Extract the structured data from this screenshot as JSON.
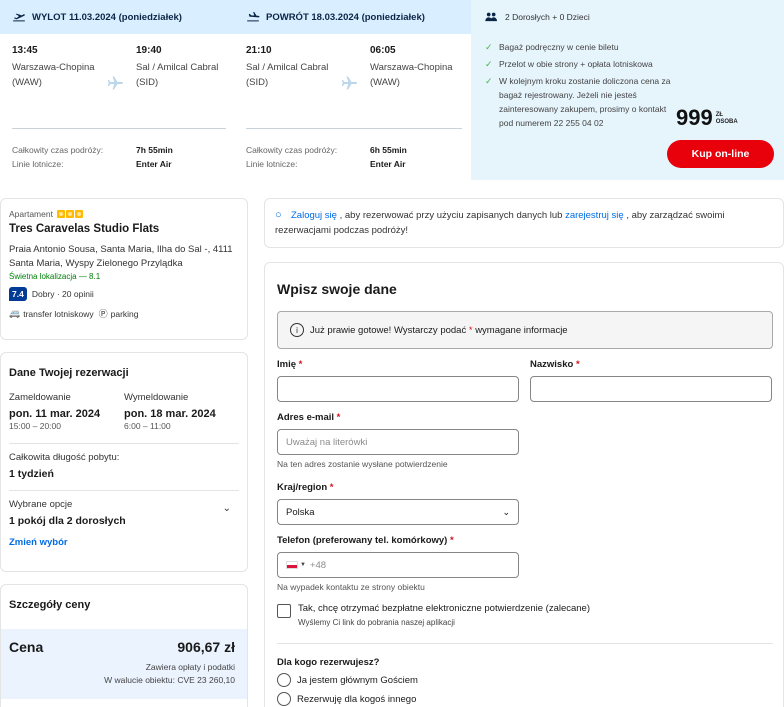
{
  "outbound": {
    "header": "WYLOT 11.03.2024 (poniedziałek)",
    "dep_time": "13:45",
    "dep_airport": "Warszawa-Chopina",
    "dep_code": "(WAW)",
    "arr_time": "19:40",
    "arr_airport": "Sal / Amilcal Cabral",
    "arr_code": "(SID)",
    "duration_label": "Całkowity czas podróży:",
    "duration": "7h 55min",
    "airline_label": "Linie lotnicze:",
    "airline": "Enter Air"
  },
  "return": {
    "header": "POWRÓT 18.03.2024 (poniedziałek)",
    "dep_time": "21:10",
    "dep_airport": "Sal / Amilcal Cabral",
    "dep_code": "(SID)",
    "arr_time": "06:05",
    "arr_airport": "Warszawa-Chopina",
    "arr_code": "(WAW)",
    "duration_label": "Całkowity czas podróży:",
    "duration": "6h 55min",
    "airline_label": "Linie lotnicze:",
    "airline": "Enter Air"
  },
  "offer": {
    "passengers": "2 Dorosłych + 0 Dzieci",
    "bullets": [
      "Bagaż podręczny w cenie biletu",
      "Przelot w obie strony + opłata lotniskowa",
      "W kolejnym kroku zostanie doliczona cena za bagaż rejestrowany. Jeżeli nie jesteś zainteresowany zakupem, prosimy o kontakt pod numerem 22 255 04 02"
    ],
    "price": "999",
    "currency": "ZŁ",
    "per": "OSOBA",
    "buy_label": "Kup on-line"
  },
  "hotel": {
    "type": "Apartament",
    "name": "Tres Caravelas Studio Flats",
    "address": "Praia Antonio Sousa, Santa Maria, Ilha do Sal -, 4111 Santa Maria, Wyspy Zielonego Przylądka",
    "location_score": "Świetna lokalizacja — 8.1",
    "score": "7.4",
    "score_text": "Dobry · 20 opinii",
    "amenity_transfer": "transfer lotniskowy",
    "amenity_parking": "parking"
  },
  "booking": {
    "title": "Dane Twojej rezerwacji",
    "checkin_label": "Zameldowanie",
    "checkin_date": "pon. 11 mar. 2024",
    "checkin_hours": "15:00 – 20:00",
    "checkout_label": "Wymeldowanie",
    "checkout_date": "pon. 18 mar. 2024",
    "checkout_hours": "6:00 – 11:00",
    "duration_label": "Całkowita długość pobytu:",
    "duration": "1 tydzień",
    "options_label": "Wybrane opcje",
    "options": "1 pokój dla 2 dorosłych",
    "change_label": "Zmień wybór"
  },
  "price_details": {
    "title": "Szczegóły ceny",
    "label": "Cena",
    "amount": "906,67 zł",
    "note1": "Zawiera opłaty i podatki",
    "note2": "W walucie obiektu: CVE 23 260,10"
  },
  "signin": {
    "link1": "Zaloguj się",
    "text1": ", aby rezerwować przy użyciu zapisanych danych lub",
    "link2": "zarejestruj się",
    "text2": ", aby zarządzać swoimi rezerwacjami podczas podróży!"
  },
  "form": {
    "title": "Wpisz swoje dane",
    "info_text": "Już prawie gotowe! Wystarczy podać",
    "info_text2": "wymagane informacje",
    "first_name_label": "Imię",
    "last_name_label": "Nazwisko",
    "email_label": "Adres e-mail",
    "email_placeholder": "Uważaj na literówki",
    "email_hint": "Na ten adres zostanie wysłane potwierdzenie",
    "country_label": "Kraj/region",
    "country_value": "Polska",
    "phone_label": "Telefon (preferowany tel. komórkowy)",
    "phone_prefix": "+48",
    "phone_hint": "Na wypadek kontaktu ze strony obiektu",
    "confirm_label": "Tak, chcę otrzymać bezpłatne elektroniczne potwierdzenie (zalecane)",
    "confirm_sub": "Wyślemy Ci link do pobrania naszej aplikacji",
    "who_label": "Dla kogo rezerwujesz?",
    "who_opt1": "Ja jestem głównym Gościem",
    "who_opt2": "Rezerwuję dla kogoś innego",
    "required_mark": "*"
  },
  "colors": {
    "accent": "#006ce4",
    "buy": "#e8000b",
    "panel": "#e6f4fc",
    "score": "#003b95"
  }
}
